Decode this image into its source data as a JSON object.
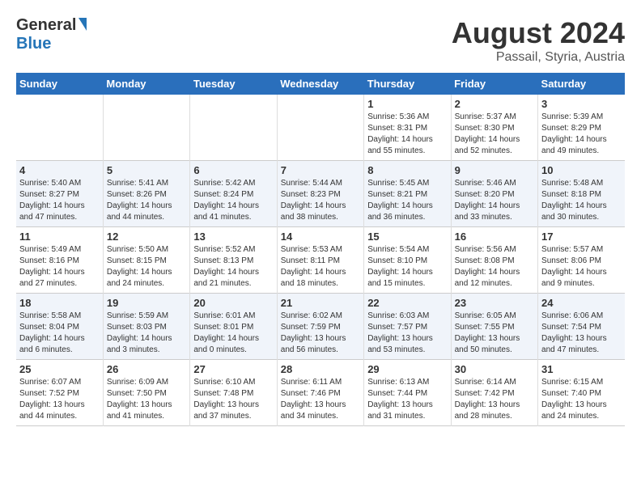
{
  "logo": {
    "general": "General",
    "blue": "Blue"
  },
  "title": "August 2024",
  "subtitle": "Passail, Styria, Austria",
  "days_of_week": [
    "Sunday",
    "Monday",
    "Tuesday",
    "Wednesday",
    "Thursday",
    "Friday",
    "Saturday"
  ],
  "weeks": [
    [
      {
        "num": "",
        "info": ""
      },
      {
        "num": "",
        "info": ""
      },
      {
        "num": "",
        "info": ""
      },
      {
        "num": "",
        "info": ""
      },
      {
        "num": "1",
        "info": "Sunrise: 5:36 AM\nSunset: 8:31 PM\nDaylight: 14 hours\nand 55 minutes."
      },
      {
        "num": "2",
        "info": "Sunrise: 5:37 AM\nSunset: 8:30 PM\nDaylight: 14 hours\nand 52 minutes."
      },
      {
        "num": "3",
        "info": "Sunrise: 5:39 AM\nSunset: 8:29 PM\nDaylight: 14 hours\nand 49 minutes."
      }
    ],
    [
      {
        "num": "4",
        "info": "Sunrise: 5:40 AM\nSunset: 8:27 PM\nDaylight: 14 hours\nand 47 minutes."
      },
      {
        "num": "5",
        "info": "Sunrise: 5:41 AM\nSunset: 8:26 PM\nDaylight: 14 hours\nand 44 minutes."
      },
      {
        "num": "6",
        "info": "Sunrise: 5:42 AM\nSunset: 8:24 PM\nDaylight: 14 hours\nand 41 minutes."
      },
      {
        "num": "7",
        "info": "Sunrise: 5:44 AM\nSunset: 8:23 PM\nDaylight: 14 hours\nand 38 minutes."
      },
      {
        "num": "8",
        "info": "Sunrise: 5:45 AM\nSunset: 8:21 PM\nDaylight: 14 hours\nand 36 minutes."
      },
      {
        "num": "9",
        "info": "Sunrise: 5:46 AM\nSunset: 8:20 PM\nDaylight: 14 hours\nand 33 minutes."
      },
      {
        "num": "10",
        "info": "Sunrise: 5:48 AM\nSunset: 8:18 PM\nDaylight: 14 hours\nand 30 minutes."
      }
    ],
    [
      {
        "num": "11",
        "info": "Sunrise: 5:49 AM\nSunset: 8:16 PM\nDaylight: 14 hours\nand 27 minutes."
      },
      {
        "num": "12",
        "info": "Sunrise: 5:50 AM\nSunset: 8:15 PM\nDaylight: 14 hours\nand 24 minutes."
      },
      {
        "num": "13",
        "info": "Sunrise: 5:52 AM\nSunset: 8:13 PM\nDaylight: 14 hours\nand 21 minutes."
      },
      {
        "num": "14",
        "info": "Sunrise: 5:53 AM\nSunset: 8:11 PM\nDaylight: 14 hours\nand 18 minutes."
      },
      {
        "num": "15",
        "info": "Sunrise: 5:54 AM\nSunset: 8:10 PM\nDaylight: 14 hours\nand 15 minutes."
      },
      {
        "num": "16",
        "info": "Sunrise: 5:56 AM\nSunset: 8:08 PM\nDaylight: 14 hours\nand 12 minutes."
      },
      {
        "num": "17",
        "info": "Sunrise: 5:57 AM\nSunset: 8:06 PM\nDaylight: 14 hours\nand 9 minutes."
      }
    ],
    [
      {
        "num": "18",
        "info": "Sunrise: 5:58 AM\nSunset: 8:04 PM\nDaylight: 14 hours\nand 6 minutes."
      },
      {
        "num": "19",
        "info": "Sunrise: 5:59 AM\nSunset: 8:03 PM\nDaylight: 14 hours\nand 3 minutes."
      },
      {
        "num": "20",
        "info": "Sunrise: 6:01 AM\nSunset: 8:01 PM\nDaylight: 14 hours\nand 0 minutes."
      },
      {
        "num": "21",
        "info": "Sunrise: 6:02 AM\nSunset: 7:59 PM\nDaylight: 13 hours\nand 56 minutes."
      },
      {
        "num": "22",
        "info": "Sunrise: 6:03 AM\nSunset: 7:57 PM\nDaylight: 13 hours\nand 53 minutes."
      },
      {
        "num": "23",
        "info": "Sunrise: 6:05 AM\nSunset: 7:55 PM\nDaylight: 13 hours\nand 50 minutes."
      },
      {
        "num": "24",
        "info": "Sunrise: 6:06 AM\nSunset: 7:54 PM\nDaylight: 13 hours\nand 47 minutes."
      }
    ],
    [
      {
        "num": "25",
        "info": "Sunrise: 6:07 AM\nSunset: 7:52 PM\nDaylight: 13 hours\nand 44 minutes."
      },
      {
        "num": "26",
        "info": "Sunrise: 6:09 AM\nSunset: 7:50 PM\nDaylight: 13 hours\nand 41 minutes."
      },
      {
        "num": "27",
        "info": "Sunrise: 6:10 AM\nSunset: 7:48 PM\nDaylight: 13 hours\nand 37 minutes."
      },
      {
        "num": "28",
        "info": "Sunrise: 6:11 AM\nSunset: 7:46 PM\nDaylight: 13 hours\nand 34 minutes."
      },
      {
        "num": "29",
        "info": "Sunrise: 6:13 AM\nSunset: 7:44 PM\nDaylight: 13 hours\nand 31 minutes."
      },
      {
        "num": "30",
        "info": "Sunrise: 6:14 AM\nSunset: 7:42 PM\nDaylight: 13 hours\nand 28 minutes."
      },
      {
        "num": "31",
        "info": "Sunrise: 6:15 AM\nSunset: 7:40 PM\nDaylight: 13 hours\nand 24 minutes."
      }
    ]
  ]
}
